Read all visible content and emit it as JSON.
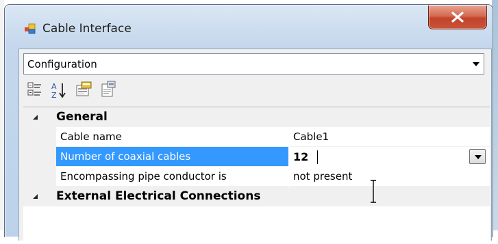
{
  "window": {
    "title": "Cable Interface",
    "icons": {
      "app": "app-icon",
      "close": "close-icon"
    }
  },
  "object_selector": {
    "selected": "Configuration",
    "icon": "chevron-down-icon"
  },
  "toolbar": {
    "buttons": [
      {
        "name": "categorized-icon"
      },
      {
        "name": "sort-alphabetical-icon"
      },
      {
        "name": "properties-icon"
      },
      {
        "name": "property-pages-icon"
      }
    ]
  },
  "property_grid": {
    "categories": [
      {
        "label": "General",
        "properties": [
          {
            "name": "Cable name",
            "value": "Cable1"
          },
          {
            "name": "Number of coaxial cables",
            "value": "12"
          },
          {
            "name": "Encompassing pipe conductor is",
            "value": "not present"
          }
        ]
      },
      {
        "label": "External Electrical Connections",
        "properties": []
      }
    ],
    "selected_property": "Number of coaxial cables"
  },
  "colors": {
    "selection": "#3399ff",
    "close_button": "#c2432a"
  }
}
